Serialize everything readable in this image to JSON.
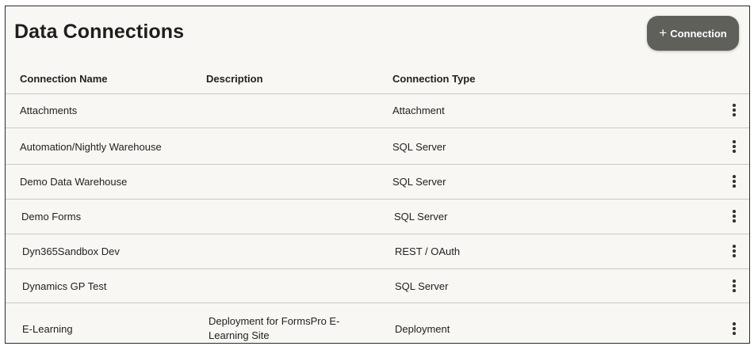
{
  "page": {
    "title": "Data Connections"
  },
  "toolbar": {
    "add_connection_label": "Connection",
    "add_icon": "plus-icon"
  },
  "table": {
    "columns": [
      "Connection Name",
      "Description",
      "Connection Type"
    ],
    "rows": [
      {
        "name": "Attachments",
        "description": "",
        "type": "Attachment"
      },
      {
        "name": "Automation/Nightly Warehouse",
        "description": "",
        "type": "SQL Server"
      },
      {
        "name": "Demo Data Warehouse",
        "description": "",
        "type": "SQL Server"
      },
      {
        "name": "Demo Forms",
        "description": "",
        "type": "SQL Server"
      },
      {
        "name": "Dyn365Sandbox Dev",
        "description": "",
        "type": "REST / OAuth"
      },
      {
        "name": "Dynamics GP Test",
        "description": "",
        "type": "SQL Server"
      },
      {
        "name": "E-Learning",
        "description": "Deployment for FormsPro E-Learning Site",
        "type": "Deployment"
      }
    ],
    "row_menu_icon": "kebab-icon"
  }
}
